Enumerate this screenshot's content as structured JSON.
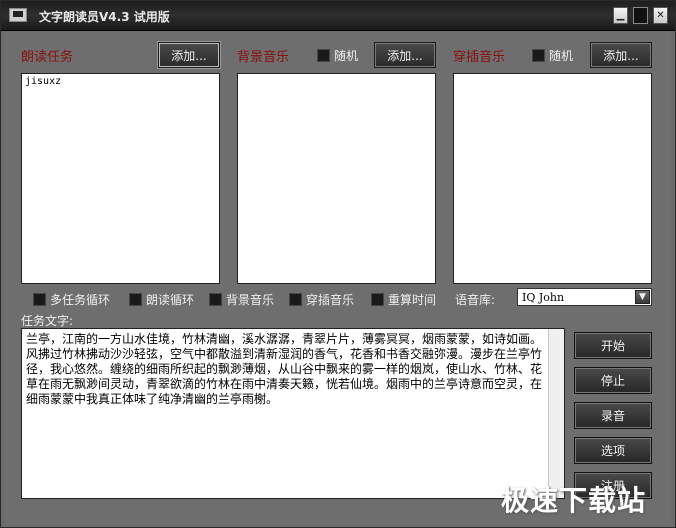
{
  "window": {
    "title": "文字朗读员V4.3 试用版"
  },
  "tasks": {
    "label": "朗读任务",
    "add_label": "添加...",
    "items": [
      "jisuxz"
    ]
  },
  "bg_music": {
    "label": "背景音乐",
    "random_label": "随机",
    "add_label": "添加..."
  },
  "insert_music": {
    "label": "穿插音乐",
    "random_label": "随机",
    "add_label": "添加..."
  },
  "options": {
    "multi_task_loop": "多任务循环",
    "read_loop": "朗读循环",
    "bg_music": "背景音乐",
    "insert_music": "穿插音乐",
    "recalc_time": "重算时间"
  },
  "voice": {
    "label": "语音库:",
    "selected": "IQ John"
  },
  "task_text": {
    "label": "任务文字:",
    "value": "兰亭，江南的一方山水佳境，竹林清幽，溪水潺潺，青翠片片，薄雾冥冥，烟雨蒙蒙，如诗如画。风拂过竹林拂动沙沙轻弦，空气中都散溢到清新湿润的香气，花香和书香交融弥漫。漫步在兰亭竹径，我心悠然。缠绕的细雨所织起的飘渺薄烟，从山谷中飘来的雾一样的烟岚，使山水、竹林、花草在雨无飘渺间灵动，青翠欲滴的竹林在雨中清奏天籁，恍若仙境。烟雨中的兰亭诗意而空灵，在细雨蒙蒙中我真正体味了纯净清幽的兰亭雨榭。"
  },
  "side_buttons": {
    "start": "开始",
    "stop": "停止",
    "record": "录音",
    "options": "选项",
    "register": "注册"
  },
  "watermark": "极速下载站"
}
